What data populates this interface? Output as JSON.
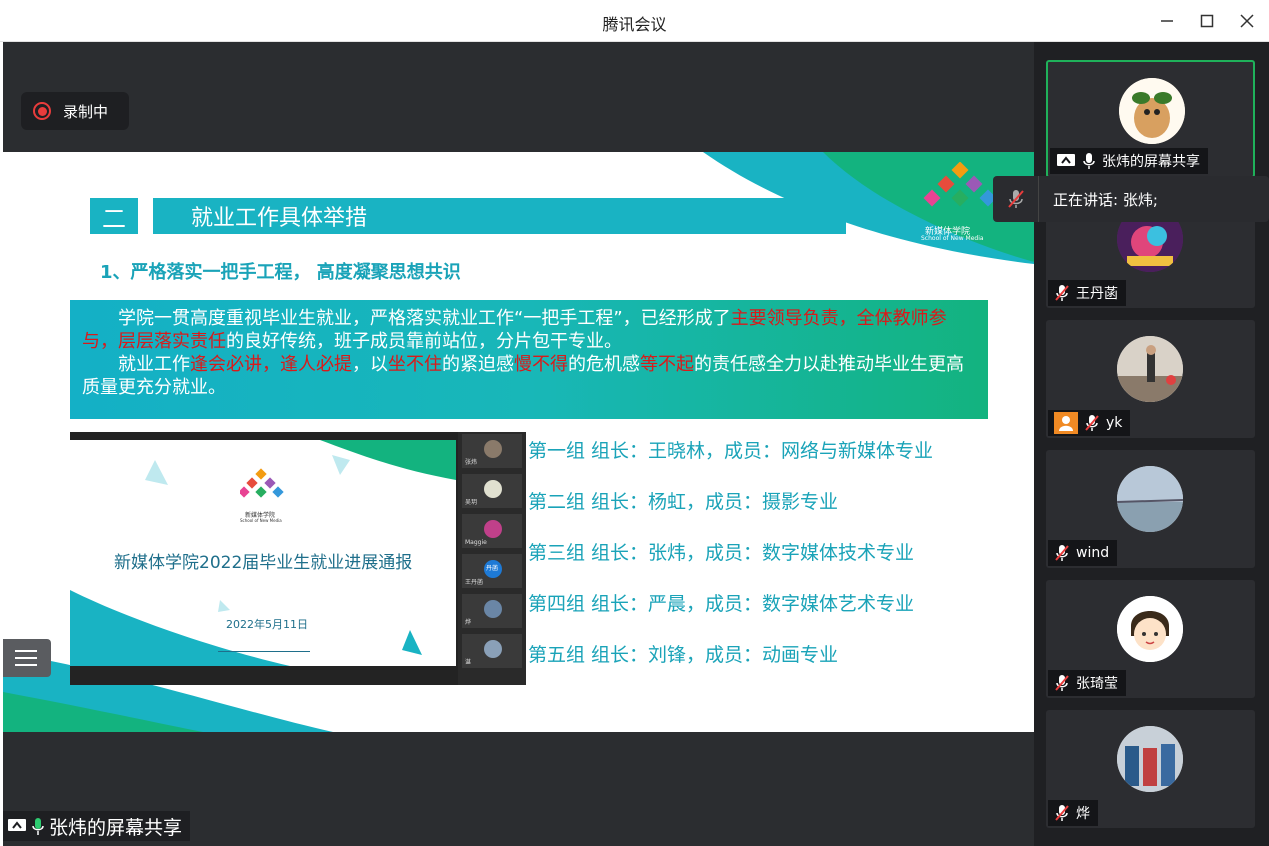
{
  "window": {
    "title": "腾讯会议",
    "min_icon": "minimize-icon",
    "max_icon": "maximize-icon",
    "close_icon": "close-icon"
  },
  "recording": {
    "label": "录制中"
  },
  "slide": {
    "section_number": "二",
    "section_title": "就业工作具体举措",
    "subheading": "1、严格落实一把手工程， 高度凝聚思想共识",
    "para1": {
      "a": "学院一贯高度重视毕业生就业，严格落实就业工作“一把手工程”，已经形成了",
      "b_red": "主要领导负责，全体教师参与，层层落实责任",
      "c": "的良好传统，班子成员靠前站位，分片包干专业。"
    },
    "para2": {
      "a": "就业工作",
      "b_red": "逢会必讲，逢人必提",
      "c": "，以",
      "d_red": "坐不住",
      "e": "的紧迫感",
      "f_red": "慢不得",
      "g": "的危机感",
      "h_red": "等不起",
      "i": "的责任感全力以赴推动毕业生更高质量更充分就业。"
    },
    "thumbnail": {
      "logo_cn": "新媒体学院",
      "logo_en": "School of New Media",
      "title": "新媒体学院2022届毕业生就业进展通报",
      "date": "2022年5月11日",
      "sidebar_names": [
        "张炜",
        "吴玥",
        "Maggie",
        "丹菡",
        "王丹菡",
        "烨",
        "谌"
      ],
      "sidebar_badge": "丹菡"
    },
    "groups": [
      "第一组 组长：王晓林，成员：网络与新媒体专业",
      "第二组 组长：杨虹，成员：摄影专业",
      "第三组 组长：张炜，成员：数字媒体技术专业",
      "第四组 组长：严晨，成员：数字媒体艺术专业",
      "第五组 组长：刘锋，成员：动画专业"
    ],
    "logo_cn": "新媒体学院",
    "logo_en": "School of New Media"
  },
  "share_tag": {
    "label": "张炜的屏幕共享"
  },
  "speaking": {
    "label": "正在讲话: 张炜;"
  },
  "participants": [
    {
      "name": "张炜的屏幕共享",
      "icon": "screen-share-icon",
      "mic": "mic-on-icon"
    },
    {
      "name": "王丹菡",
      "mic": "mic-muted-icon"
    },
    {
      "name": "yk",
      "mic": "mic-muted-icon",
      "extra_icon": "user-icon"
    },
    {
      "name": "wind",
      "mic": "mic-muted-icon"
    },
    {
      "name": "张琦莹",
      "mic": "mic-muted-icon"
    },
    {
      "name": "烨",
      "mic": "mic-muted-icon"
    }
  ],
  "colors": {
    "accent_teal": "#19b3c3",
    "accent_green": "#13b37f",
    "highlight_red": "#d91a1a",
    "active_border": "#1fb15a"
  }
}
